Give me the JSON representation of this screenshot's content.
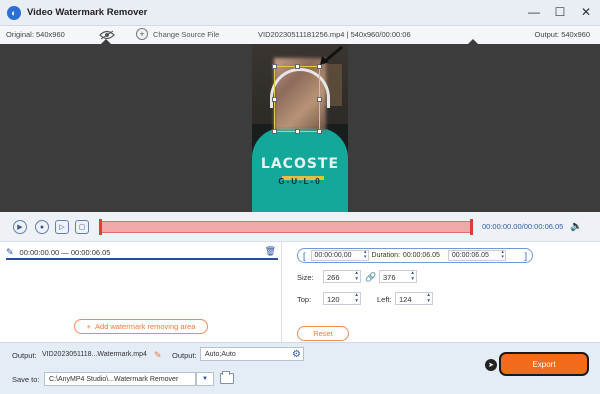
{
  "window": {
    "title": "Video Watermark Remover",
    "controls": {
      "minimize": "—",
      "maximize": "☐",
      "close": "✕"
    }
  },
  "infobar": {
    "original": "Original: 540x960",
    "change_source": "Change Source File",
    "filename": "VID20230511181256.mp4",
    "file_meta": "540x960/00:00:06",
    "output": "Output: 540x960"
  },
  "playback": {
    "time_current": "00:00:00.00",
    "time_total": "00:00:06.05",
    "time_sep": "/"
  },
  "segment": {
    "start": "00:00:00.00",
    "dash": "—",
    "end": "00:00:06.05"
  },
  "add_area_label": "Add watermark removing area",
  "range": {
    "start": "00:00:00.00",
    "duration_label": "Duration:",
    "duration": "00:00:06.05",
    "end": "00:00:06.05"
  },
  "area": {
    "size_label": "Size:",
    "width": "266",
    "height": "376",
    "top_label": "Top:",
    "top": "120",
    "left_label": "Left:",
    "left": "124"
  },
  "reset_label": "Reset",
  "footer": {
    "output_label": "Output:",
    "output_file": "VID2023051118...Watermark.mp4",
    "output_format_label": "Output:",
    "output_format": "Auto;Auto",
    "save_label": "Save to:",
    "save_path": "C:\\AnyMP4 Studio\\...Watermark Remover",
    "export_label": "Export"
  },
  "video_text": {
    "line1": "LACOSTE",
    "line2": "G-U-L-0"
  },
  "colors": {
    "accent": "#f26b1d",
    "primary": "#2a5faa",
    "timeline": "#f1a8a8"
  }
}
